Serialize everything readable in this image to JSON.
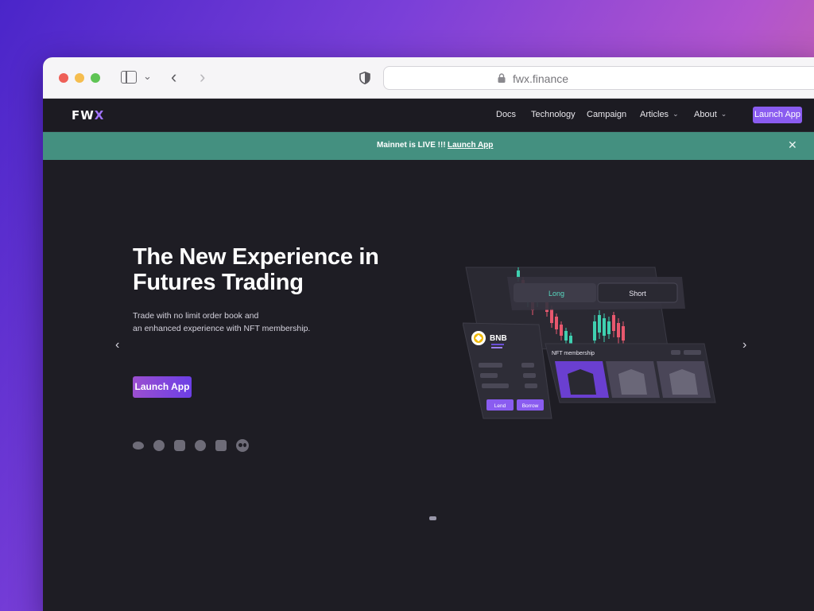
{
  "browser": {
    "url": "fwx.finance"
  },
  "header": {
    "logo": "FWX",
    "nav": [
      {
        "label": "Docs",
        "has_dropdown": false
      },
      {
        "label": "Technology",
        "has_dropdown": false
      },
      {
        "label": "Campaign",
        "has_dropdown": false
      },
      {
        "label": "Articles",
        "has_dropdown": true
      },
      {
        "label": "About",
        "has_dropdown": true
      }
    ],
    "cta": "Launch App",
    "accent": "#8a5cf0"
  },
  "banner": {
    "message": "Mainnet is LIVE !!!",
    "link": "Launch App",
    "background": "#449080"
  },
  "hero": {
    "title_line1": "The New Experience in",
    "title_line2": "Futures Trading",
    "subtitle_line1": "Trade with no limit order book and",
    "subtitle_line2": "an enhanced experience with NFT membership.",
    "cta": "Launch App",
    "socials": [
      "twitter-icon",
      "telegram-icon",
      "discord-icon",
      "facebook-icon",
      "youtube-icon",
      "medium-icon"
    ]
  },
  "illustration": {
    "toggle_long": "Long",
    "toggle_short": "Short",
    "token": "BNB",
    "nft_label": "NFT membership",
    "lend": "Lend",
    "borrow": "Borrow"
  }
}
